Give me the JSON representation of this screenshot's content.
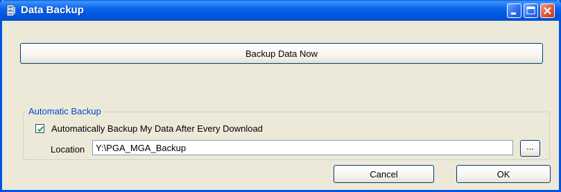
{
  "window": {
    "title": "Data Backup",
    "app_icon": "app-data-icon",
    "controls": {
      "minimize": "minimize-icon",
      "maximize": "maximize-icon",
      "close": "close-icon"
    }
  },
  "actions": {
    "backup_now_label": "Backup Data Now"
  },
  "automatic_backup": {
    "group_label": "Automatic Backup",
    "checkbox_label": "Automatically Backup My Data After Every Download",
    "checkbox_checked": true,
    "location_label": "Location",
    "location_value": "Y:\\PGA_MGA_Backup",
    "browse_label": "..."
  },
  "footer": {
    "cancel_label": "Cancel",
    "ok_label": "OK"
  },
  "colors": {
    "titlebar": "#0058e0",
    "window_bg": "#ece9d8",
    "group_label": "#0046d5",
    "close_button": "#e2553a"
  }
}
